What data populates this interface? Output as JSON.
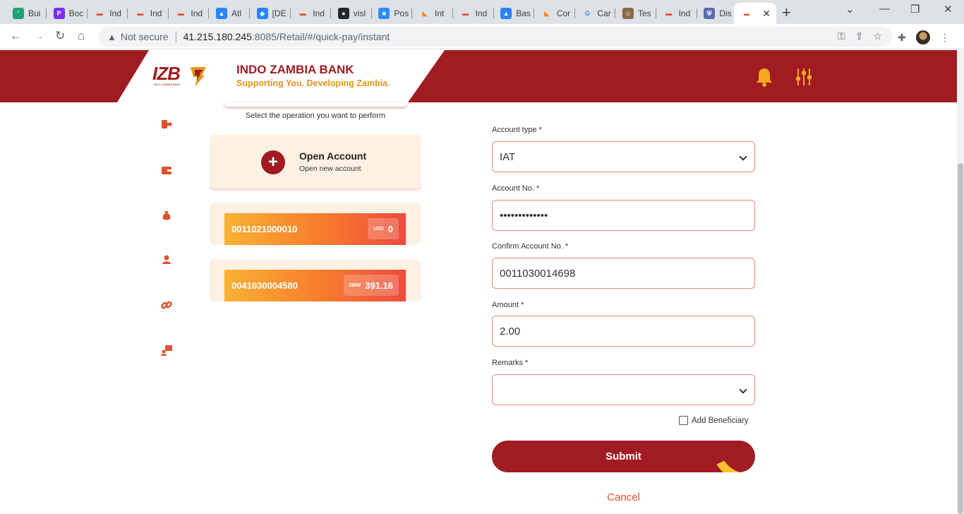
{
  "browser": {
    "tabs": [
      {
        "label": "Bui",
        "icon": "sitebuilder-icon",
        "color": "#1aa376"
      },
      {
        "label": "Boc",
        "icon": "p-icon",
        "color": "#7b2ff7"
      },
      {
        "label": "Ind",
        "icon": "izb-icon",
        "color": "#e0522d"
      },
      {
        "label": "Ind",
        "icon": "izb-icon",
        "color": "#e0522d"
      },
      {
        "label": "Ind",
        "icon": "izb-icon",
        "color": "#e0522d"
      },
      {
        "label": "Atl",
        "icon": "atlassian-icon",
        "color": "#2684ff"
      },
      {
        "label": "[DE",
        "icon": "jira-icon",
        "color": "#2684ff"
      },
      {
        "label": "Ind",
        "icon": "izb-icon",
        "color": "#e0522d"
      },
      {
        "label": "visl",
        "icon": "github-icon",
        "color": "#24292f"
      },
      {
        "label": "Pos",
        "icon": "zoom-icon",
        "color": "#2d8cff"
      },
      {
        "label": "Int",
        "icon": "metamask-icon",
        "color": "#f6851b"
      },
      {
        "label": "Ind",
        "icon": "izb-icon",
        "color": "#e0522d"
      },
      {
        "label": "Bas",
        "icon": "atlassian-icon",
        "color": "#2684ff"
      },
      {
        "label": "Cor",
        "icon": "metamask-icon",
        "color": "#f6851b"
      },
      {
        "label": "Car",
        "icon": "google-icon",
        "color": "#4285f4"
      },
      {
        "label": "Tes",
        "icon": "person-icon",
        "color": "#8a6a4a"
      },
      {
        "label": "Ind",
        "icon": "izb-icon",
        "color": "#e0522d"
      },
      {
        "label": "Dis",
        "icon": "shield-icon",
        "color": "#5a6ab0"
      }
    ],
    "active_tab_icon": "izb-icon",
    "address": {
      "security": "Not secure",
      "host": "41.215.180.245",
      "path": ":8085/Retail/#/quick-pay/instant"
    }
  },
  "bank": {
    "name": "INDO ZAMBIA BANK",
    "tagline": "Supporting You. Developing Zambia.",
    "logo_text": "IZB",
    "logo_sub": "INDO ZAMBIA BANK"
  },
  "colors": {
    "primary": "#a01c22",
    "accent": "#e0961a",
    "field_border": "#e58a73"
  },
  "left": {
    "hint": "Select the operation you want to perform",
    "open_account": {
      "title": "Open Account",
      "subtitle": "Open new account"
    },
    "accounts": [
      {
        "number": "0011021000010",
        "currency": "USD",
        "balance": "0"
      },
      {
        "number": "0041030004580",
        "currency": "ZMW",
        "balance": "391.16"
      }
    ]
  },
  "form": {
    "account_type": {
      "label": "Account type *",
      "value": "IAT"
    },
    "account_no": {
      "label": "Account No. *",
      "value": "•••••••••••••"
    },
    "confirm_account_no": {
      "label": "Confirm Account No. *",
      "value": "0011030014698"
    },
    "amount": {
      "label": "Amount *",
      "value": "2.00"
    },
    "remarks": {
      "label": "Remarks *",
      "value": ""
    },
    "add_beneficiary": "Add Beneficiary",
    "submit": "Submit",
    "cancel": "Cancel"
  }
}
